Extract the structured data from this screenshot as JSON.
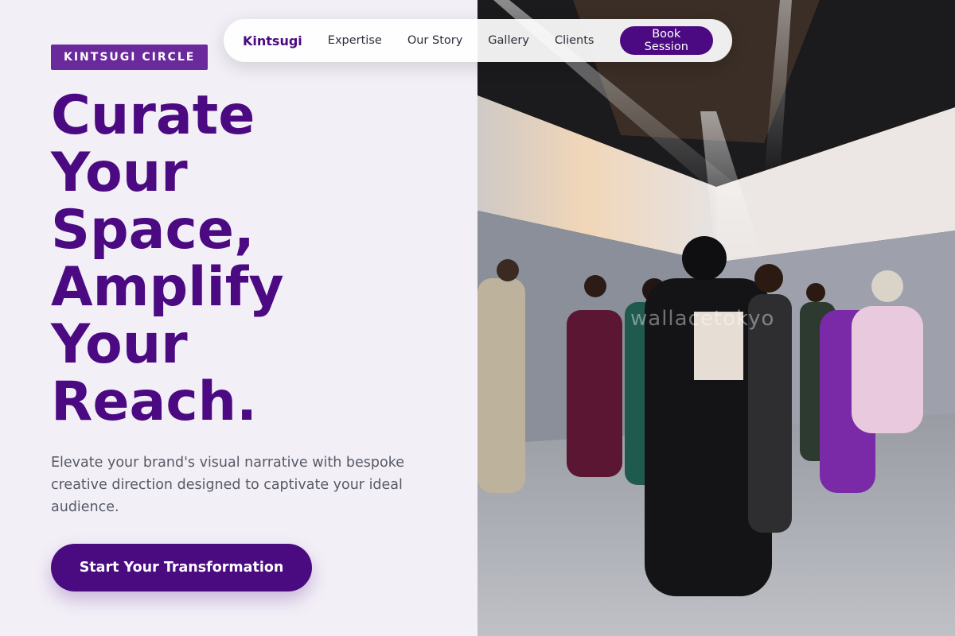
{
  "badge": {
    "label": "KINTSUGI CIRCLE"
  },
  "hero": {
    "headline_lines": [
      "Curate",
      "Your",
      "Space,",
      "Amplify",
      "Your",
      "Reach."
    ],
    "subtext": "Elevate your brand's visual narrative with bespoke creative direction designed to captivate your ideal audience.",
    "cta_label": "Start Your Transformation"
  },
  "nav": {
    "brand": "Kintsugi",
    "links": [
      "Expertise",
      "Our Story",
      "Gallery",
      "Clients"
    ],
    "book_label": "Book Session"
  },
  "image": {
    "description_icon": "fashion-photo-image",
    "watermark": "wallacetokyo"
  },
  "colors": {
    "brand_purple": "#4b0a82",
    "badge_purple": "#6a2a9c",
    "page_bg": "#f3eff7"
  }
}
